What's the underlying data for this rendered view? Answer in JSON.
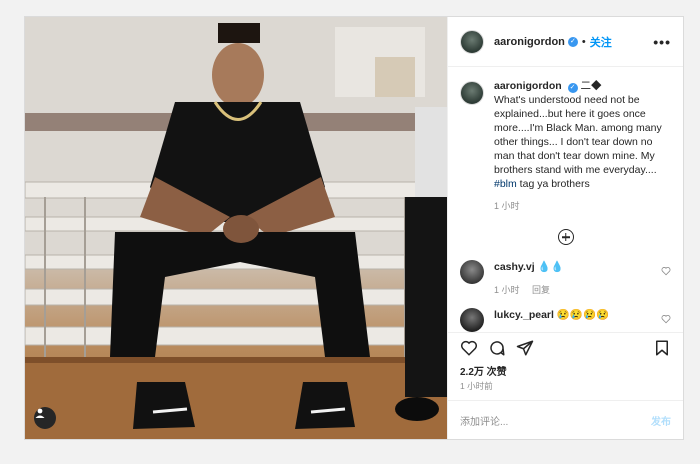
{
  "post": {
    "username": "aaronigordon",
    "follow_label": "关注",
    "more_label": "•••",
    "caption": {
      "username": "aaronigordon",
      "emoji": "二◆",
      "text": "What's understood need not be explained...but here it goes once more....I'm Black Man. among many other things... I don't tear down no man that don't tear down mine. My brothers stand with me everyday....",
      "hashtag": "#blm",
      "tail": " tag ya brothers",
      "time": "1 小时"
    },
    "comments": [
      {
        "username": "cashy.vj",
        "text": "💧💧",
        "time": "1 小时",
        "reply": "回复"
      },
      {
        "username": "lukcy._pearl",
        "text": "😢😢😢😢"
      }
    ],
    "likes": "2.2万 次赞",
    "post_time": "1 小时前",
    "comment_placeholder": "添加评论...",
    "post_button": "发布"
  },
  "icons": {
    "heart": "heart-icon",
    "comment": "comment-icon",
    "share": "share-icon",
    "save": "bookmark-icon",
    "tag": "user-tag-icon"
  },
  "colors": {
    "accent": "#0095f6",
    "verified": "#3897f0",
    "post_disabled": "#b2dffc"
  }
}
